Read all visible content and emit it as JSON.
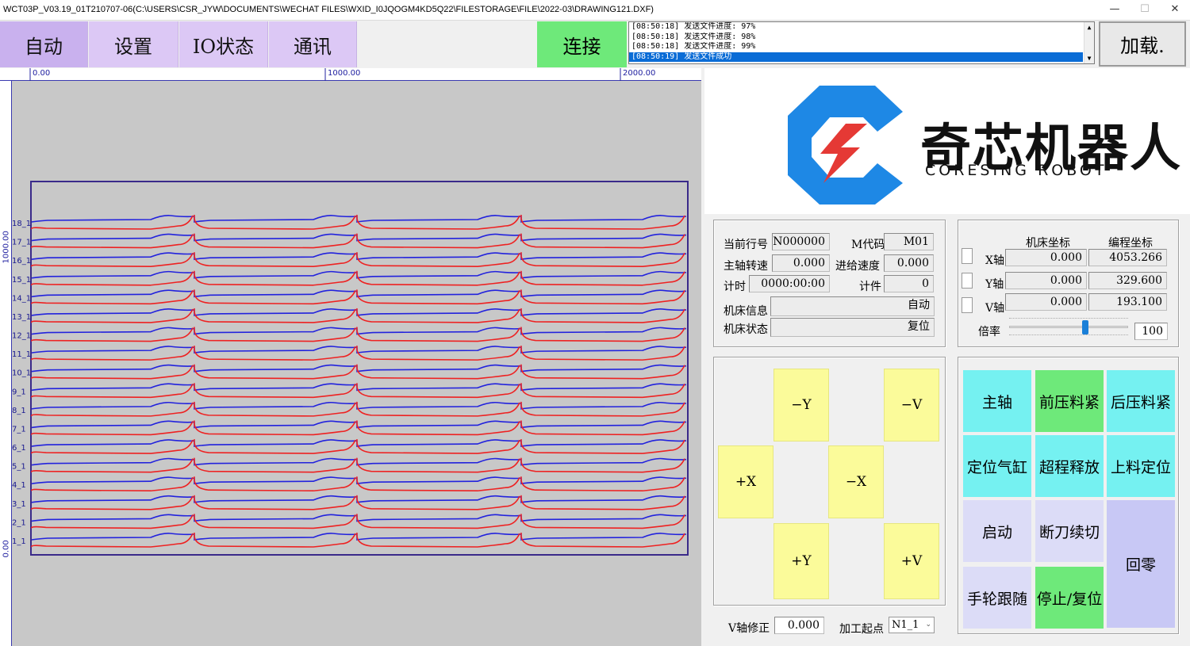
{
  "window": {
    "title": "WCT03P_V03.19_01T210707-06(C:\\USERS\\CSR_JYW\\DOCUMENTS\\WECHAT FILES\\WXID_I0JQOGM4KD5Q22\\FILESTORAGE\\FILE\\2022-03\\DRAWING121.DXF)",
    "minimize": "—",
    "maximize": "☐",
    "close": "✕"
  },
  "nav": {
    "auto": "自动",
    "settings": "设置",
    "io_status": "IO状态",
    "comm": "通讯",
    "connect": "连接",
    "load": "加载."
  },
  "log": {
    "lines": [
      "[08:50:18] 发送文件进度: 97%",
      "[08:50:18] 发送文件进度: 98%",
      "[08:50:18] 发送文件进度: 99%",
      "[08:50:19] 发送文件成功"
    ],
    "up_arrow": "▲",
    "down_arrow": "▼"
  },
  "ruler": {
    "top": [
      "0.00",
      "1000.00",
      "2000.00"
    ],
    "left": [
      "1000.00",
      "0.00"
    ]
  },
  "drawing": {
    "row_labels": [
      "18_1",
      "17_1",
      "16_1",
      "15_1",
      "14_1",
      "13_1",
      "12_1",
      "11_1",
      "10_1",
      "9_1",
      "8_1",
      "7_1",
      "6_1",
      "5_1",
      "4_1",
      "3_1",
      "2_1",
      "1_1"
    ],
    "colors": {
      "blue": "#2222dd",
      "red": "#ee2222",
      "frame": "#3a2a8a"
    }
  },
  "logo": {
    "cn": "奇芯机器人",
    "en": "CORESING ROBOT",
    "colors": {
      "blue": "#1e88e5",
      "red": "#e53935"
    }
  },
  "status": {
    "current_line_label": "当前行号",
    "current_line_value": "N000000",
    "m_code_label": "M代码",
    "m_code_value": "M01",
    "spindle_speed_label": "主轴转速",
    "spindle_speed_value": "0.000",
    "feed_speed_label": "进给速度",
    "feed_speed_value": "0.000",
    "timer_label": "计时",
    "timer_value": "0000:00:00",
    "count_label": "计件",
    "count_value": "0",
    "machine_info_label": "机床信息",
    "machine_info_value": "自动",
    "machine_state_label": "机床状态",
    "machine_state_value": "复位"
  },
  "coords": {
    "machine_header": "机床坐标",
    "program_header": "编程坐标",
    "axes": [
      {
        "name": "X轴",
        "machine": "0.000",
        "program": "4053.266"
      },
      {
        "name": "Y轴",
        "machine": "0.000",
        "program": "329.600"
      },
      {
        "name": "V轴",
        "machine": "0.000",
        "program": "193.100"
      }
    ],
    "rate_label": "倍率",
    "rate_value": "100",
    "rate_fraction": 0.65
  },
  "jog": {
    "minus_y": "−Y",
    "minus_v": "−V",
    "plus_x": "+X",
    "minus_x": "−X",
    "plus_y": "+Y",
    "plus_v": "+V"
  },
  "bottom": {
    "v_correction_label": "V轴修正",
    "v_correction_value": "0.000",
    "start_point_label": "加工起点",
    "start_point_value": "N1_1"
  },
  "functions": {
    "spindle": "主轴",
    "front_clamp": "前压料紧",
    "rear_clamp": "后压料紧",
    "locate_cylinder": "定位气缸",
    "overtravel_release": "超程释放",
    "feed_locate": "上料定位",
    "start": "启动",
    "break_resume": "断刀续切",
    "home": "回零",
    "handwheel_follow": "手轮跟随",
    "stop_reset": "停止/复位"
  }
}
